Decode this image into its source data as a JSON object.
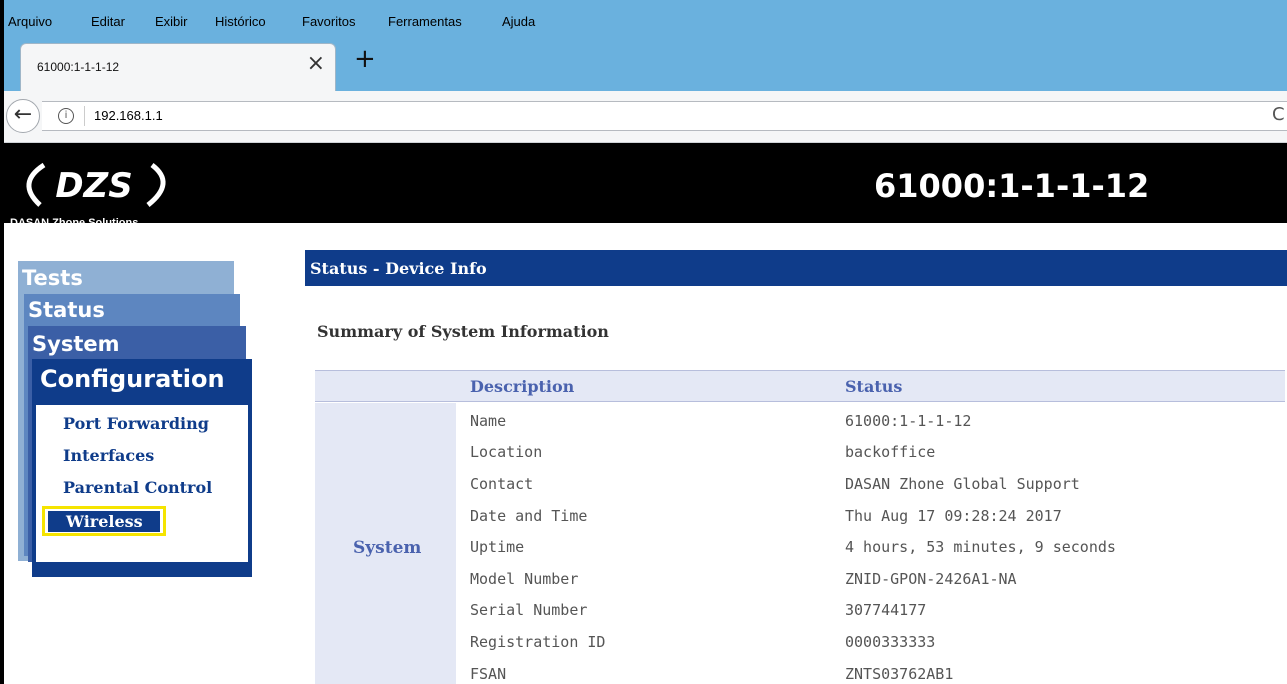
{
  "menubar": {
    "items": [
      "Arquivo",
      "Editar",
      "Exibir",
      "Histórico",
      "Favoritos",
      "Ferramentas",
      "Ajuda"
    ]
  },
  "browser": {
    "tab_title": "61000:1-1-1-12",
    "tab_close_glyph": "×",
    "new_tab_glyph": "+",
    "url": "192.168.1.1",
    "back_glyph": "←",
    "info_glyph": "i",
    "reload_glyph": "C"
  },
  "header": {
    "logo_wordmark": "DZS",
    "logo_text": "DASAN Zhone Solutions",
    "title": "61000:1-1-1-12"
  },
  "left_menu": {
    "tests": "Tests",
    "status": "Status",
    "system": "System",
    "configuration": "Configuration",
    "submenu": [
      "Port Forwarding",
      "Interfaces",
      "Parental Control"
    ],
    "selected": "Wireless"
  },
  "content": {
    "section_title": "Status - Device Info",
    "summary_title": "Summary of System Information",
    "table": {
      "headers": [
        "Description",
        "Status"
      ],
      "group": "System",
      "rows": [
        [
          "Name",
          "61000:1-1-1-12"
        ],
        [
          "Location",
          "backoffice"
        ],
        [
          "Contact",
          "DASAN Zhone Global Support"
        ],
        [
          "Date and Time",
          "Thu Aug 17 09:28:24 2017"
        ],
        [
          "Uptime",
          "4 hours, 53 minutes, 9 seconds"
        ],
        [
          "Model Number",
          "ZNID-GPON-2426A1-NA"
        ],
        [
          "Serial Number",
          "307744177"
        ],
        [
          "Registration ID",
          "0000333333"
        ],
        [
          "FSAN",
          "ZNTS03762AB1"
        ]
      ]
    }
  },
  "colors": {
    "menubar": "#6ab1de",
    "brand_blue": "#0f3c8a",
    "highlight": "#f5e400"
  }
}
